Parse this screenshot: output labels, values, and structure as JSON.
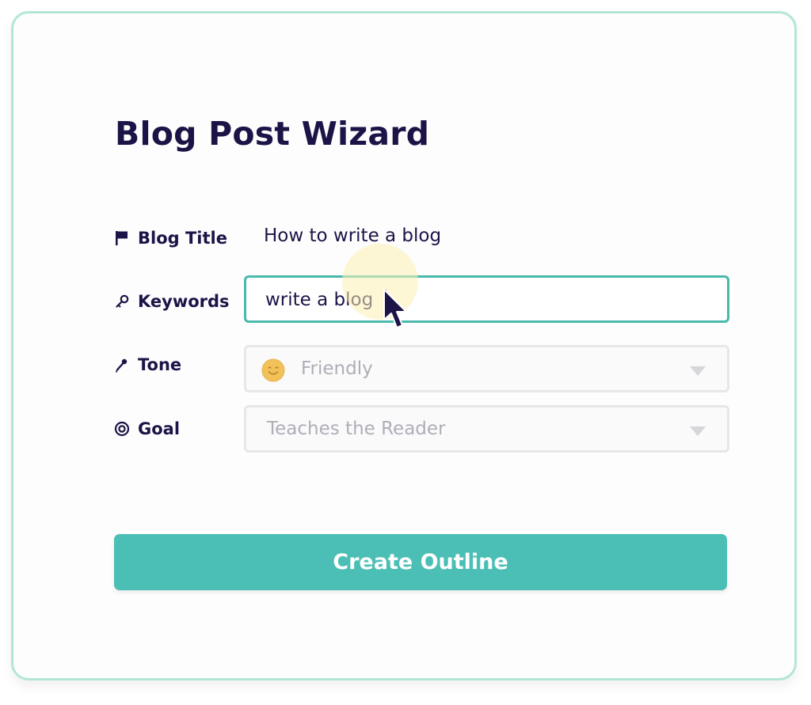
{
  "wizard": {
    "title": "Blog Post Wizard",
    "fields": {
      "blog_title": {
        "label": "Blog Title",
        "value": "How to write a blog",
        "icon": "flag-icon"
      },
      "keywords": {
        "label": "Keywords",
        "value": "write a blog",
        "icon": "key-icon"
      },
      "tone": {
        "label": "Tone",
        "selected": "Friendly",
        "icon": "microphone-icon",
        "option_icon": "smiley-icon"
      },
      "goal": {
        "label": "Goal",
        "selected": "Teaches the Reader",
        "icon": "target-icon"
      }
    },
    "submit_label": "Create Outline"
  },
  "colors": {
    "text_primary": "#1c1447",
    "accent": "#4bbfb5",
    "card_border": "#b3e6d7",
    "disabled_text": "#aeaeb8"
  }
}
